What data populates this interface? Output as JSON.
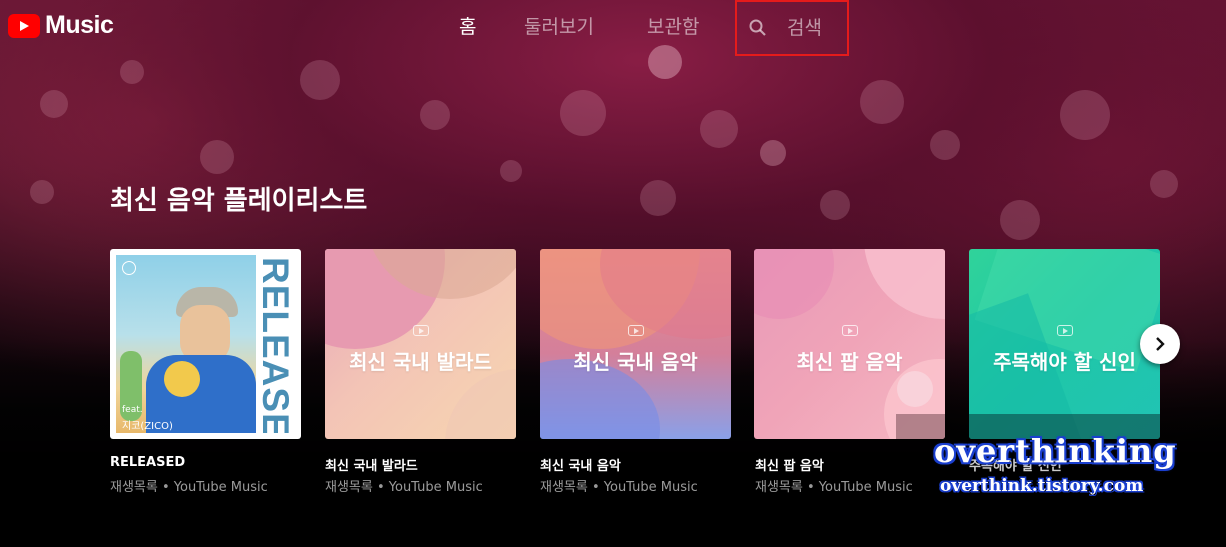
{
  "app": {
    "logo_text": "Music"
  },
  "nav": {
    "items": [
      {
        "label": "홈",
        "active": true
      },
      {
        "label": "둘러보기",
        "active": false
      },
      {
        "label": "보관함",
        "active": false
      }
    ],
    "search_label": "검색"
  },
  "section": {
    "title": "최신 음악 플레이리스트"
  },
  "cards": [
    {
      "cover_vertical_text": "RELEASED",
      "cover_feat": "feat.",
      "cover_artist": "지코(ZICO)",
      "title": "RELEASED",
      "subtitle": "재생목록 • YouTube Music"
    },
    {
      "cover_text": "최신 국내 발라드",
      "title": "최신 국내 발라드",
      "subtitle": "재생목록 • YouTube Music"
    },
    {
      "cover_text": "최신 국내 음악",
      "title": "최신 국내 음악",
      "subtitle": "재생목록 • YouTube Music"
    },
    {
      "cover_text": "최신 팝 음악",
      "title": "최신 팝 음악",
      "subtitle": "재생목록 • YouTube Music"
    },
    {
      "cover_text": "주목해야 할 신인",
      "title": "주목해야 할 신인"
    }
  ],
  "watermark": {
    "line1": "overthinking",
    "line2": "overthink.tistory.com"
  },
  "colors": {
    "brand_red": "#ff0000",
    "search_highlight": "#e51b1b"
  }
}
